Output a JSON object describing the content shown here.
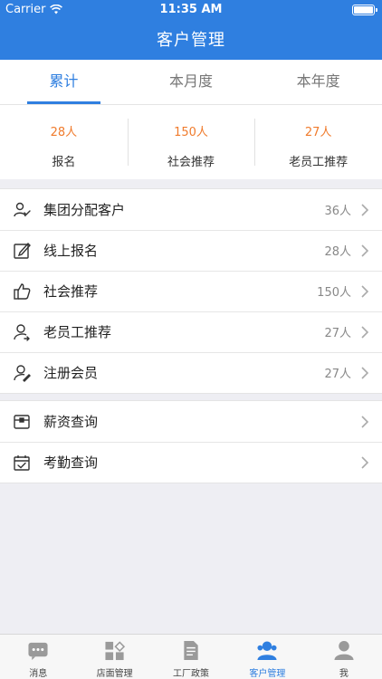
{
  "status_bar": {
    "carrier": "Carrier",
    "time": "11:35 AM"
  },
  "nav": {
    "title": "客户管理"
  },
  "tabs": [
    {
      "label": "累计",
      "active": true
    },
    {
      "label": "本月度",
      "active": false
    },
    {
      "label": "本年度",
      "active": false
    }
  ],
  "stats": [
    {
      "value": "28人",
      "label": "报名"
    },
    {
      "value": "150人",
      "label": "社会推荐"
    },
    {
      "value": "27人",
      "label": "老员工推荐"
    }
  ],
  "customer_list": [
    {
      "icon": "group-assign-icon",
      "label": "集团分配客户",
      "count": "36人"
    },
    {
      "icon": "edit-form-icon",
      "label": "线上报名",
      "count": "28人"
    },
    {
      "icon": "thumbs-up-icon",
      "label": "社会推荐",
      "count": "150人"
    },
    {
      "icon": "user-referral-icon",
      "label": "老员工推荐",
      "count": "27人"
    },
    {
      "icon": "user-edit-icon",
      "label": "注册会员",
      "count": "27人"
    }
  ],
  "query_list": [
    {
      "icon": "wallet-icon",
      "label": "薪资查询"
    },
    {
      "icon": "calendar-check-icon",
      "label": "考勤查询"
    }
  ],
  "tab_bar": [
    {
      "icon": "message-icon",
      "label": "消息",
      "active": false
    },
    {
      "icon": "store-grid-icon",
      "label": "店面管理",
      "active": false
    },
    {
      "icon": "document-icon",
      "label": "工厂政策",
      "active": false
    },
    {
      "icon": "customers-icon",
      "label": "客户管理",
      "active": true
    },
    {
      "icon": "profile-icon",
      "label": "我",
      "active": false
    }
  ],
  "colors": {
    "primary": "#2f7fe0",
    "accent_orange": "#f07b2c",
    "background": "#eeeef3"
  }
}
